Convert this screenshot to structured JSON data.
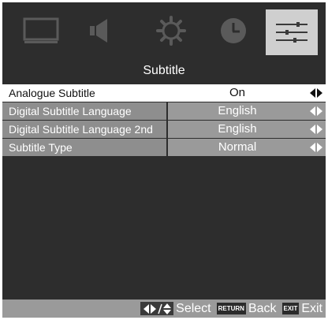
{
  "tabs": [
    {
      "icon": "picture-icon"
    },
    {
      "icon": "sound-icon"
    },
    {
      "icon": "setup-gear-icon"
    },
    {
      "icon": "time-clock-icon"
    },
    {
      "icon": "option-sliders-icon",
      "active": true
    }
  ],
  "section": {
    "title": "Subtitle"
  },
  "menu": {
    "items": [
      {
        "label": "Analogue Subtitle",
        "value": "On",
        "selected": true
      },
      {
        "label": "Digital Subtitle Language",
        "value": "English"
      },
      {
        "label": "Digital Subtitle Language 2nd",
        "value": "English"
      },
      {
        "label": "Subtitle Type",
        "value": "Normal"
      }
    ]
  },
  "footer": {
    "select_label": "Select",
    "return_key": "RETURN",
    "back_label": "Back",
    "exit_key": "EXIT",
    "exit_label": "Exit"
  },
  "colors": {
    "background": "#2d2d2d",
    "row_normal": "#9a9a9a",
    "row_selected": "#ffffff",
    "active_tab": "#cfcfcf"
  }
}
